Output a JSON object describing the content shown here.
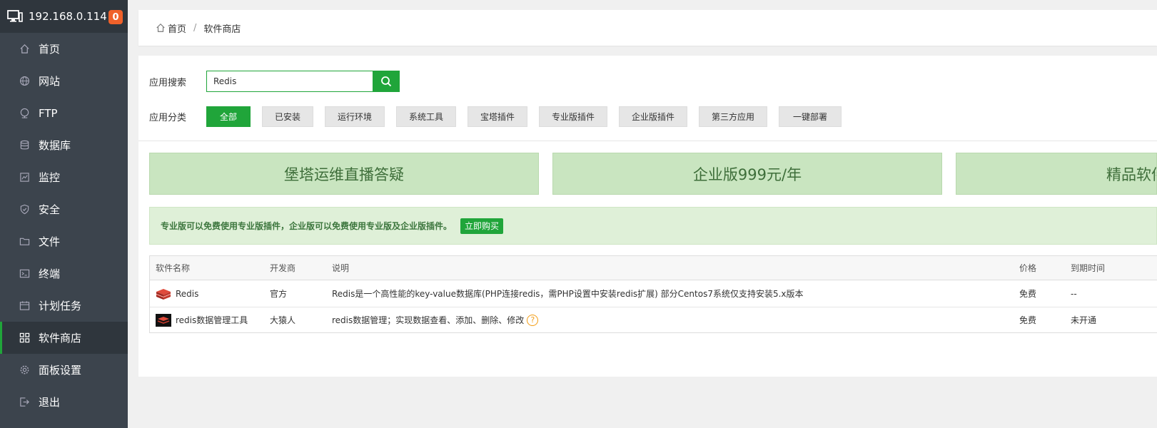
{
  "sidebar": {
    "host": "192.168.0.114",
    "badge": "0",
    "items": [
      {
        "label": "首页",
        "icon": "home-icon"
      },
      {
        "label": "网站",
        "icon": "globe-icon"
      },
      {
        "label": "FTP",
        "icon": "ftp-icon"
      },
      {
        "label": "数据库",
        "icon": "database-icon"
      },
      {
        "label": "监控",
        "icon": "monitor-chart-icon"
      },
      {
        "label": "安全",
        "icon": "shield-icon"
      },
      {
        "label": "文件",
        "icon": "folder-icon"
      },
      {
        "label": "终端",
        "icon": "terminal-icon"
      },
      {
        "label": "计划任务",
        "icon": "calendar-icon"
      },
      {
        "label": "软件商店",
        "icon": "grid-icon"
      },
      {
        "label": "面板设置",
        "icon": "gear-icon"
      },
      {
        "label": "退出",
        "icon": "logout-icon"
      }
    ],
    "active_item": "软件商店"
  },
  "breadcrumb": {
    "home": "首页",
    "separator": "/",
    "current": "软件商店"
  },
  "search": {
    "label": "应用搜索",
    "value": "Redis"
  },
  "categories": {
    "label": "应用分类",
    "items": [
      "全部",
      "已安装",
      "运行环境",
      "系统工具",
      "宝塔插件",
      "专业版插件",
      "企业版插件",
      "第三方应用",
      "一键部署"
    ],
    "active": "全部"
  },
  "banners": [
    "堡塔运维直播答疑",
    "企业版999元/年",
    "精品软件"
  ],
  "notice": {
    "text": "专业版可以免费使用专业版插件，企业版可以免费使用专业版及企业版插件。",
    "button": "立即购买"
  },
  "table": {
    "headers": [
      "软件名称",
      "开发商",
      "说明",
      "价格",
      "到期时间"
    ],
    "rows": [
      {
        "name": "Redis",
        "developer": "官方",
        "description": "Redis是一个高性能的key-value数据库(PHP连接redis，需PHP设置中安装redis扩展) 部分Centos7系统仅支持安装5.x版本",
        "price": "免费",
        "expiry": "--"
      },
      {
        "name": "redis数据管理工具",
        "developer": "大猿人",
        "description": "redis数据管理；实现数据查看、添加、删除、修改",
        "price": "免费",
        "expiry": "未开通"
      }
    ]
  },
  "colors": {
    "brand_green": "#20a53a",
    "sidebar_bg": "#3c444d",
    "badge_orange": "#f0612a"
  }
}
